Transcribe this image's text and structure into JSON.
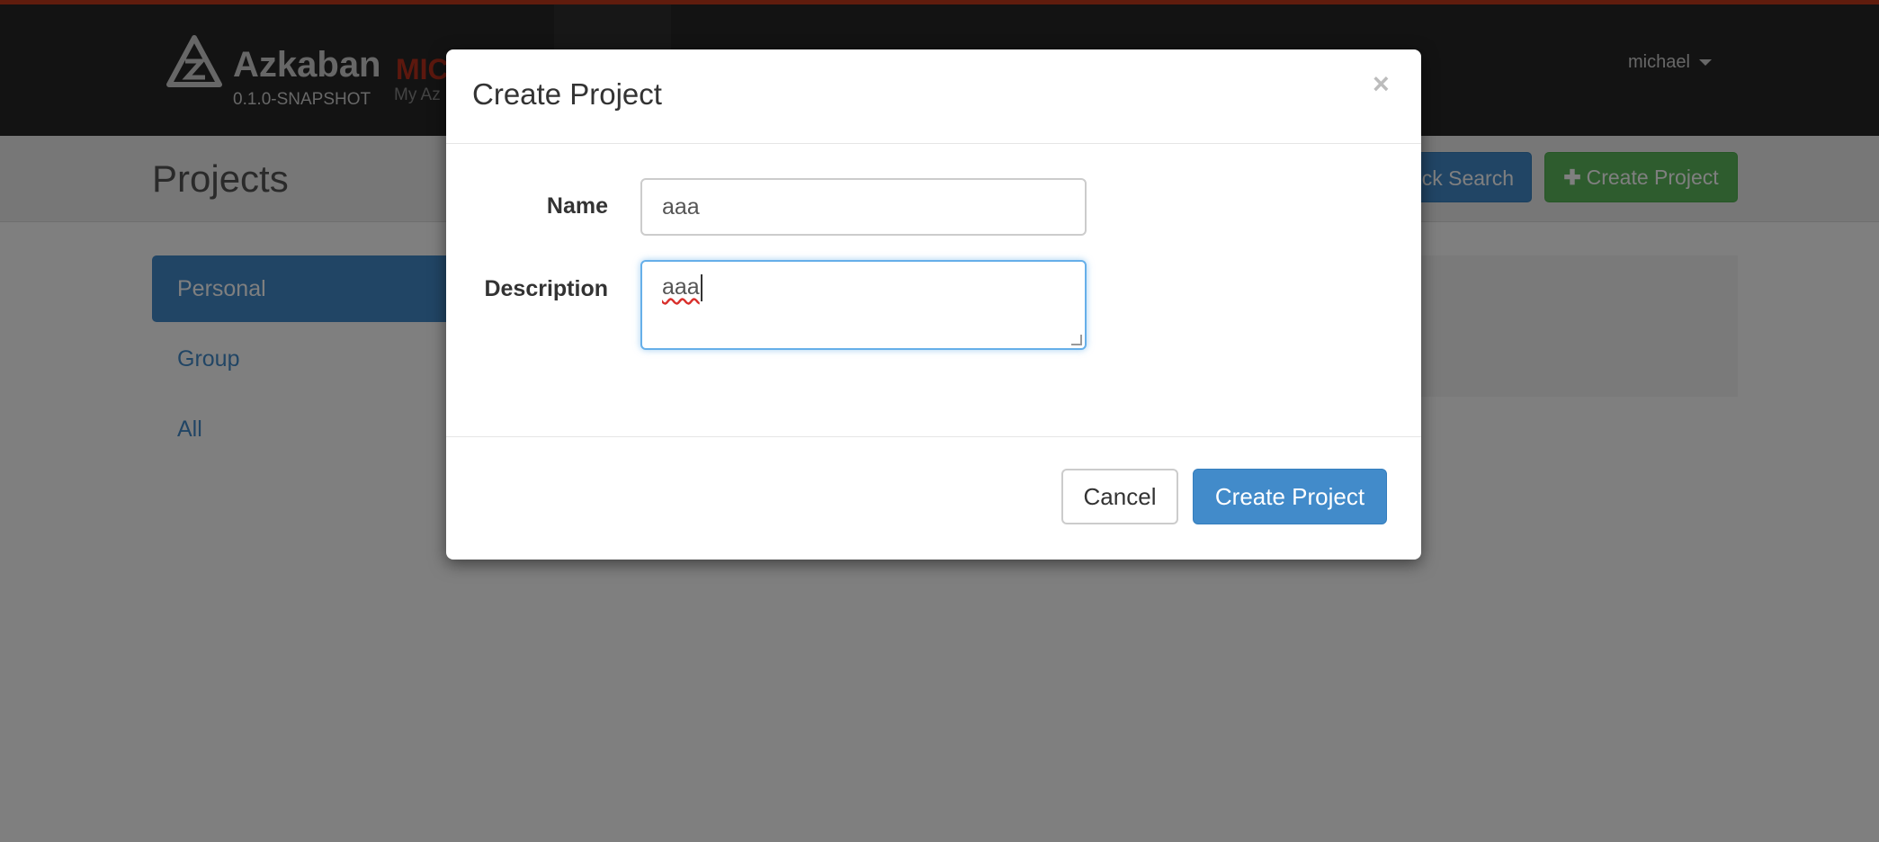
{
  "app": {
    "brand": "Azkaban",
    "environment": "MIC",
    "version": "0.1.0-SNAPSHOT",
    "subtitle": "My Az",
    "user": "michael"
  },
  "header": {
    "page_title": "Projects",
    "quick_search_label": "ick Search",
    "create_project_label": "Create Project"
  },
  "sidebar": {
    "items": [
      {
        "label": "Personal",
        "active": true
      },
      {
        "label": "Group",
        "active": false
      },
      {
        "label": "All",
        "active": false
      }
    ]
  },
  "modal": {
    "title": "Create Project",
    "close_symbol": "×",
    "fields": {
      "name_label": "Name",
      "name_value": "aaa",
      "description_label": "Description",
      "description_value": "aaa"
    },
    "buttons": {
      "cancel": "Cancel",
      "submit": "Create Project"
    }
  },
  "colors": {
    "accent_bar": "#c0391b",
    "navbar": "#262626",
    "primary": "#428bca",
    "success": "#5cb85c"
  }
}
